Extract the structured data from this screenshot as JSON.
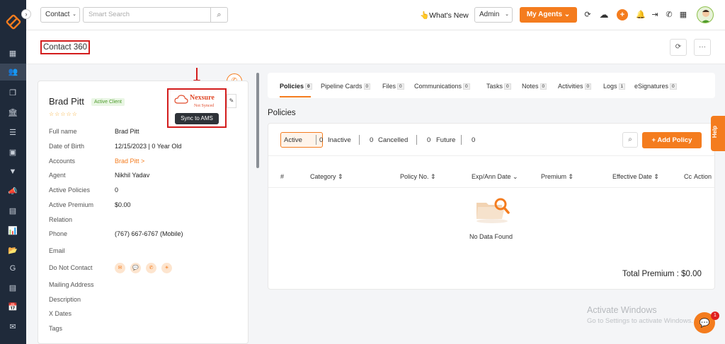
{
  "sidebar": {
    "toggle": "›",
    "icons": [
      "dashboard-icon",
      "contacts-icon",
      "documents-icon",
      "bank-icon",
      "list-icon",
      "contact-card-icon",
      "funnel-icon",
      "megaphone-icon",
      "file-icon",
      "chart-icon",
      "folder-icon",
      "google-icon",
      "page-icon",
      "calendar-icon",
      "mail-icon"
    ],
    "glyphs": [
      "▦",
      "👥",
      "❐",
      "🏛",
      "☰",
      "▣",
      "▼",
      "📣",
      "▤",
      "📊",
      "📂",
      "G",
      "▤",
      "📅",
      "✉"
    ]
  },
  "topbar": {
    "contact_select": "Contact",
    "search_placeholder": "Smart Search",
    "whats_new": "👆What's New",
    "admin_select": "Admin",
    "my_agents": "My Agents ⌄",
    "avatar_initial": ""
  },
  "page": {
    "title": "Contact 360",
    "refresh_glyph": "⟳",
    "more_glyph": "···"
  },
  "contact": {
    "name": "Brad Pitt",
    "status_badge": "Active Client",
    "stars": "☆☆☆☆☆",
    "fields": [
      {
        "label": "Full name",
        "value": "Brad Pitt"
      },
      {
        "label": "Date of Birth",
        "value": "12/15/2023 | 0 Year Old"
      },
      {
        "label": "Accounts",
        "value": "Brad Pitt >"
      },
      {
        "label": "Agent",
        "value": "Nikhil Yadav"
      },
      {
        "label": "Active Policies",
        "value": "0"
      },
      {
        "label": "Active Premium",
        "value": "$0.00"
      },
      {
        "label": "Relation",
        "value": ""
      },
      {
        "label": "Phone",
        "value": "(767) 667-6767 (Mobile)"
      },
      {
        "label": "Email",
        "value": ""
      },
      {
        "label": "Do Not Contact",
        "value": ""
      },
      {
        "label": "Mailing Address",
        "value": ""
      },
      {
        "label": "Description",
        "value": ""
      },
      {
        "label": "X Dates",
        "value": ""
      },
      {
        "label": "Tags",
        "value": ""
      }
    ],
    "dnc_icons": [
      "mail-icon",
      "chat-icon",
      "phone-icon",
      "sun-icon"
    ],
    "dnc_glyphs": [
      "✉",
      "💬",
      "✆",
      "☀"
    ]
  },
  "nexsure": {
    "logo_text": "Nexsure",
    "status": "Not Synced",
    "tooltip": "Sync to AMS"
  },
  "tabs": [
    {
      "label": "Policies",
      "count": "0"
    },
    {
      "label": "Pipeline Cards",
      "count": "0"
    },
    {
      "label": "Files",
      "count": "0"
    },
    {
      "label": "Communications",
      "count": "0"
    },
    {
      "label": "Tasks",
      "count": "0"
    },
    {
      "label": "Notes",
      "count": "0"
    },
    {
      "label": "Activities",
      "count": "0"
    },
    {
      "label": "Logs",
      "count": "1"
    },
    {
      "label": "eSignatures",
      "count": "0"
    }
  ],
  "policies": {
    "section_title": "Policies",
    "filters": [
      {
        "label": "Active",
        "count": "0"
      },
      {
        "label": "Inactive",
        "count": "0"
      },
      {
        "label": "Cancelled",
        "count": "0"
      },
      {
        "label": "Future",
        "count": "0"
      }
    ],
    "add_button": "+ Add Policy",
    "columns": [
      "#",
      "Category ⇕",
      "Policy No. ⇕",
      "Exp/Ann Date ⌄",
      "Premium ⇕",
      "Effective Date ⇕",
      "Cc",
      "Action"
    ],
    "empty_text": "No Data Found",
    "total_premium": "Total Premium : $0.00"
  },
  "help": "Help",
  "chat": {
    "glyph": "💬",
    "badge": "1"
  },
  "watermark": {
    "line1": "Activate Windows",
    "line2": "Go to Settings to activate Windows."
  },
  "colors": {
    "accent": "#f47c1e",
    "sidebar": "#1f2a3a",
    "highlight": "#d31c1c"
  }
}
